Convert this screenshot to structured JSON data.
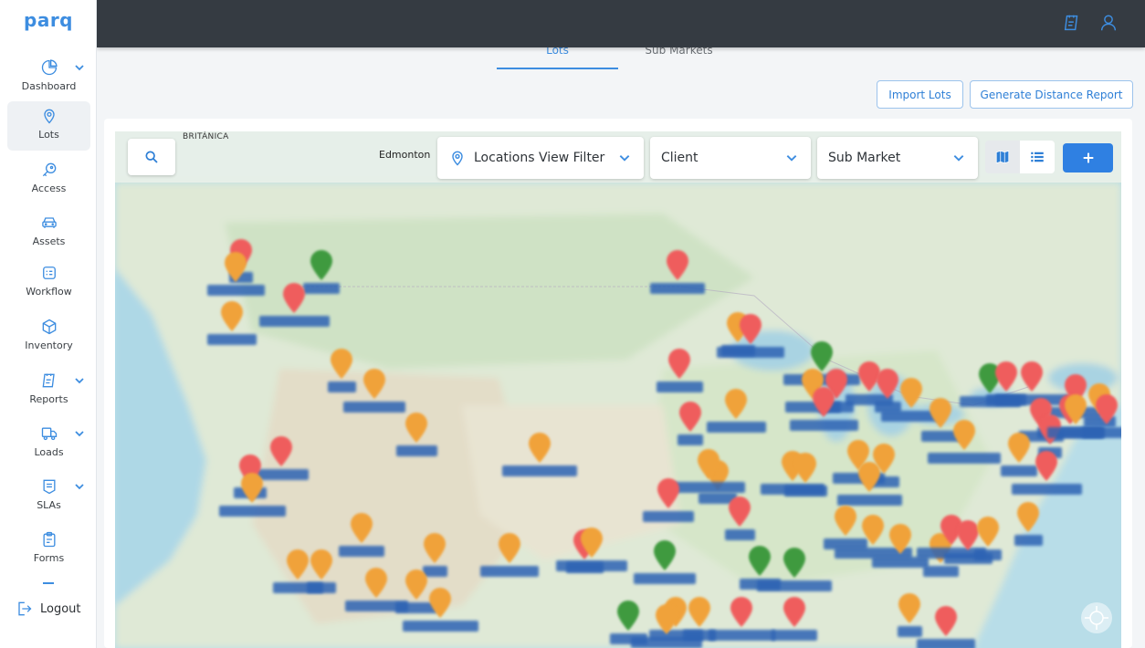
{
  "logo": {
    "word": "parq",
    "sub": ""
  },
  "sidebar": {
    "items": [
      {
        "label": "Dashboard",
        "icon": "pie-chart-icon",
        "has_chevron": true
      },
      {
        "label": "Lots",
        "icon": "location-pin-icon",
        "has_chevron": false,
        "active": true
      },
      {
        "label": "Access",
        "icon": "key-icon",
        "has_chevron": false
      },
      {
        "label": "Assets",
        "icon": "car-icon",
        "has_chevron": false
      },
      {
        "label": "Workflow",
        "icon": "workflow-icon",
        "has_chevron": false
      },
      {
        "label": "Inventory",
        "icon": "box-icon",
        "has_chevron": false
      },
      {
        "label": "Reports",
        "icon": "report-icon",
        "has_chevron": true
      },
      {
        "label": "Loads",
        "icon": "truck-icon",
        "has_chevron": true
      },
      {
        "label": "SLAs",
        "icon": "sla-icon",
        "has_chevron": true
      },
      {
        "label": "Forms",
        "icon": "clipboard-icon",
        "has_chevron": false
      }
    ],
    "logout_label": "Logout"
  },
  "topbar": {
    "icons": [
      "report-icon",
      "user-icon"
    ]
  },
  "tabs": [
    {
      "label": "Lots",
      "active": true
    },
    {
      "label": "Sub Markets",
      "active": false
    }
  ],
  "actions": {
    "import_label": "Import Lots",
    "report_label": "Generate Distance Report"
  },
  "map": {
    "region_text": "BRITÁNICA",
    "city_label": "Edmonton",
    "filters": {
      "locations": "Locations View Filter",
      "client": "Client",
      "sub_market": "Sub Market"
    },
    "view_modes": [
      "map-icon",
      "list-icon"
    ],
    "add_icon": "plus-icon"
  },
  "colors": {
    "accent": "#3d8de0",
    "topbar": "#353b42",
    "pin_orange": "#f0a23a",
    "pin_red": "#ef5d5d",
    "pin_green": "#3f9a3f",
    "label_blue": "#2d63b4"
  }
}
